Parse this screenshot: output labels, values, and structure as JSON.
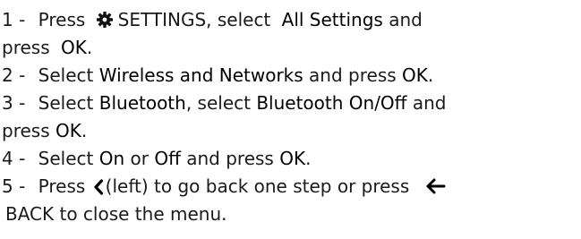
{
  "steps": [
    {
      "num": "1 -",
      "press": "Press",
      "settings_label": "SETTINGS, select",
      "all_settings": "All Settings",
      "and": "and",
      "press2": "press",
      "ok": "OK",
      "period": "."
    },
    {
      "num": "2 -",
      "select": "Select",
      "target": "Wireless and Networks",
      "and_press": "and press",
      "ok": "OK",
      "period": "."
    },
    {
      "num": "3 -",
      "select": "Select",
      "target": "Bluetooth",
      "comma_select": ", select",
      "target2": "Bluetooth On/Off",
      "and": "and",
      "press": "press",
      "ok": "OK",
      "period": "."
    },
    {
      "num": "4 -",
      "select": "Select",
      "on": "On",
      "or": "or",
      "off": "Off",
      "and_press": "and press",
      "ok": "OK",
      "period": "."
    },
    {
      "num": "5 -",
      "press": "Press",
      "left_text": "(left) to go back one step or press",
      "back_text": "BACK to close the menu."
    }
  ],
  "icons": {
    "settings": "gear-icon",
    "left": "chevron-left-icon",
    "back": "back-arrow-icon"
  },
  "colors": {
    "text": "#1a1a1a"
  }
}
